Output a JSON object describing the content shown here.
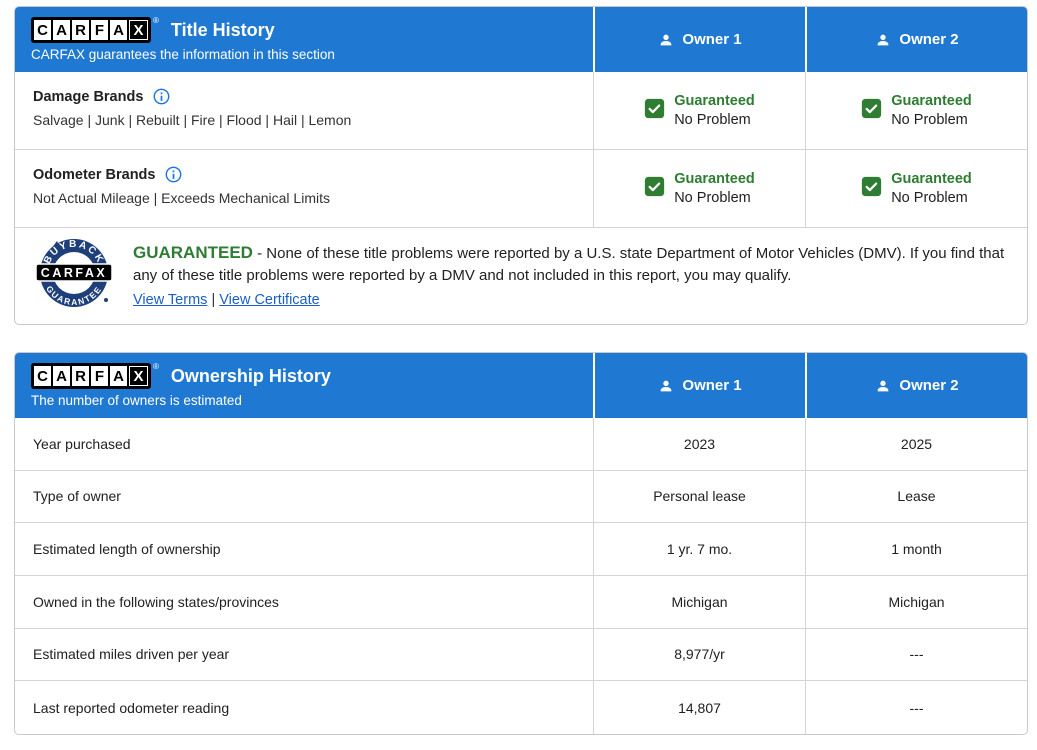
{
  "colors": {
    "header_blue": "#1f78d2",
    "guarantee_green": "#2e7d32",
    "link_blue": "#1a5fc8",
    "badge_navy": "#1e3f7a",
    "divider_gray": "#d4d4d4"
  },
  "logo": {
    "letters": [
      "C",
      "A",
      "R",
      "F",
      "A"
    ],
    "x": "X",
    "registered": "®"
  },
  "title_history": {
    "title": "Title History",
    "subtitle": "CARFAX guarantees the information in this section",
    "owners": [
      {
        "label": "Owner 1"
      },
      {
        "label": "Owner 2"
      }
    ],
    "rows": [
      {
        "label": "Damage Brands",
        "sublabel": "Salvage | Junk | Rebuilt | Fire | Flood | Hail | Lemon",
        "cells": [
          {
            "line1": "Guaranteed",
            "line2": "No Problem"
          },
          {
            "line1": "Guaranteed",
            "line2": "No Problem"
          }
        ]
      },
      {
        "label": "Odometer Brands",
        "sublabel": "Not Actual Mileage | Exceeds Mechanical Limits",
        "cells": [
          {
            "line1": "Guaranteed",
            "line2": "No Problem"
          },
          {
            "line1": "Guaranteed",
            "line2": "No Problem"
          }
        ]
      }
    ],
    "guarantee": {
      "badge": {
        "top": "BUYBACK",
        "middle": "CARFAX",
        "bottom": "GUARANTEE"
      },
      "heading": "GUARANTEED",
      "text": "- None of these title problems were reported by a U.S. state Department of Motor Vehicles (DMV). If you find that any of these title problems were reported by a DMV and not included in this report, you may qualify.",
      "links": [
        {
          "label": "View Terms"
        },
        {
          "label": "View Certificate"
        }
      ],
      "link_separator": "|"
    }
  },
  "ownership_history": {
    "title": "Ownership History",
    "subtitle": "The number of owners is estimated",
    "owners": [
      {
        "label": "Owner 1"
      },
      {
        "label": "Owner 2"
      }
    ],
    "rows": [
      {
        "label": "Year purchased",
        "values": [
          "2023",
          "2025"
        ]
      },
      {
        "label": "Type of owner",
        "values": [
          "Personal lease",
          "Lease"
        ]
      },
      {
        "label": "Estimated length of ownership",
        "values": [
          "1 yr. 7 mo.",
          "1 month"
        ]
      },
      {
        "label": "Owned in the following states/provinces",
        "values": [
          "Michigan",
          "Michigan"
        ]
      },
      {
        "label": "Estimated miles driven per year",
        "values": [
          "8,977/yr",
          "---"
        ]
      },
      {
        "label": "Last reported odometer reading",
        "values": [
          "14,807",
          "---"
        ]
      }
    ]
  }
}
